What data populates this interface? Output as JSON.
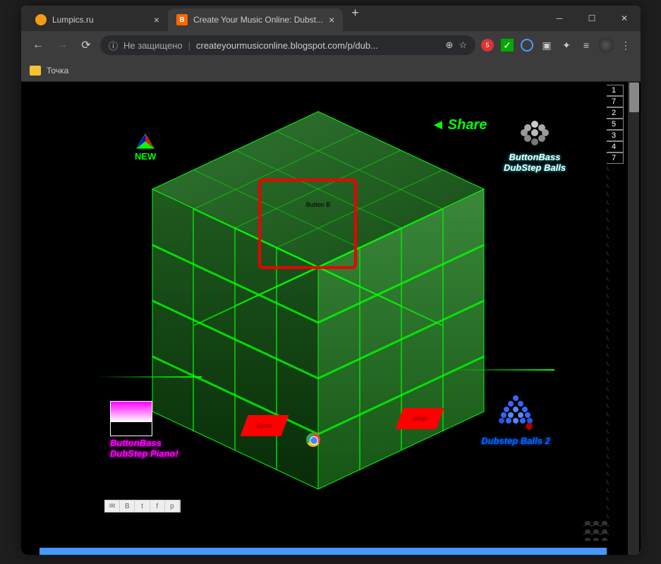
{
  "window": {
    "tabs": [
      {
        "title": "Lumpics.ru",
        "active": false
      },
      {
        "title": "Create Your Music Online: Dubst...",
        "active": true
      }
    ]
  },
  "addressbar": {
    "security_label": "Не защищено",
    "url": "createyourmusiconline.blogspot.com/p/dub...",
    "extension_badge": "5"
  },
  "bookmarks": {
    "item1": "Точка"
  },
  "counter": [
    "1",
    "7",
    "2",
    "5",
    "3",
    "4",
    "7"
  ],
  "app": {
    "new_label": "NEW",
    "share_label": "Share",
    "balls1_line1": "ButtonBass",
    "balls1_line2": "DubStep Balls",
    "piano_line1": "ButtonBass",
    "piano_line2": "DubStep Piano!",
    "balls2_label": "Dubstep Balls 2",
    "sync_label": "Sync",
    "stop_label": "Stop",
    "cube_text": "Button B"
  }
}
